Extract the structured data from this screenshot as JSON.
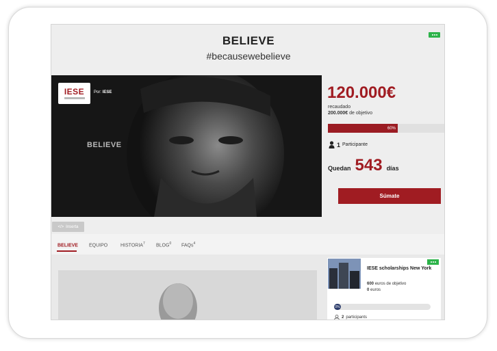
{
  "project": {
    "title": "BELIEVE",
    "hashtag": "#becausewebelieve"
  },
  "video": {
    "logo_text": "IESE",
    "by_label": "Por:",
    "by_name": "IESE",
    "overlay_word": "BELIEVE"
  },
  "funding": {
    "amount": "120.000€",
    "raised_label": "recaudado",
    "goal_amount": "200.000€",
    "goal_label": "de objetivo",
    "progress_label": "60%",
    "progress_fraction": 0.6,
    "participants_count": "1",
    "participants_label": "Participante",
    "remaining_prefix": "Quedan",
    "remaining_days": "543",
    "remaining_suffix": "días",
    "join_button": "Súmate"
  },
  "embed": {
    "label": "Inserta"
  },
  "tabs": [
    {
      "label": "BELIEVE",
      "count": ""
    },
    {
      "label": "EQUIPO",
      "count": ""
    },
    {
      "label": "HISTORIA",
      "count": "7"
    },
    {
      "label": "BLOG",
      "count": "0"
    },
    {
      "label": "FAQs",
      "count": "4"
    }
  ],
  "related": {
    "title": "IESE scholarships New York",
    "goal_amount": "600",
    "goal_label": "euros de objetivo",
    "raised_amount": "0",
    "raised_label": "euros",
    "progress_label": "0%",
    "participants_count": "2",
    "participants_label": "participants"
  },
  "colors": {
    "accent": "#a01c22",
    "badge": "#2db34a",
    "background": "#eeeeee"
  }
}
